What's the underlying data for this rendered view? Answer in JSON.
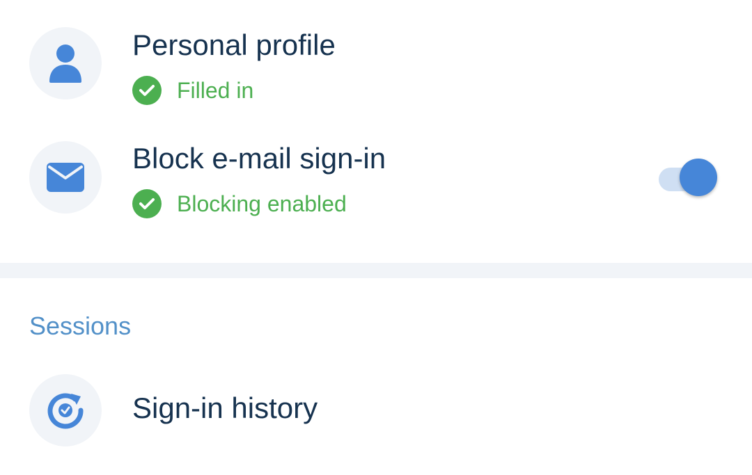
{
  "personal_profile": {
    "title": "Personal profile",
    "status": "Filled in",
    "icon": "user-icon"
  },
  "block_email": {
    "title": "Block e-mail sign-in",
    "status": "Blocking enabled",
    "icon": "envelope-icon",
    "toggle_on": true
  },
  "sessions": {
    "header": "Sessions",
    "sign_in_history": {
      "title": "Sign-in history",
      "icon": "history-icon"
    }
  },
  "colors": {
    "title_text": "#16324f",
    "accent_blue": "#4686d8",
    "success_green": "#4caf50",
    "section_header": "#5290c8",
    "icon_bg": "#f1f4f8"
  }
}
